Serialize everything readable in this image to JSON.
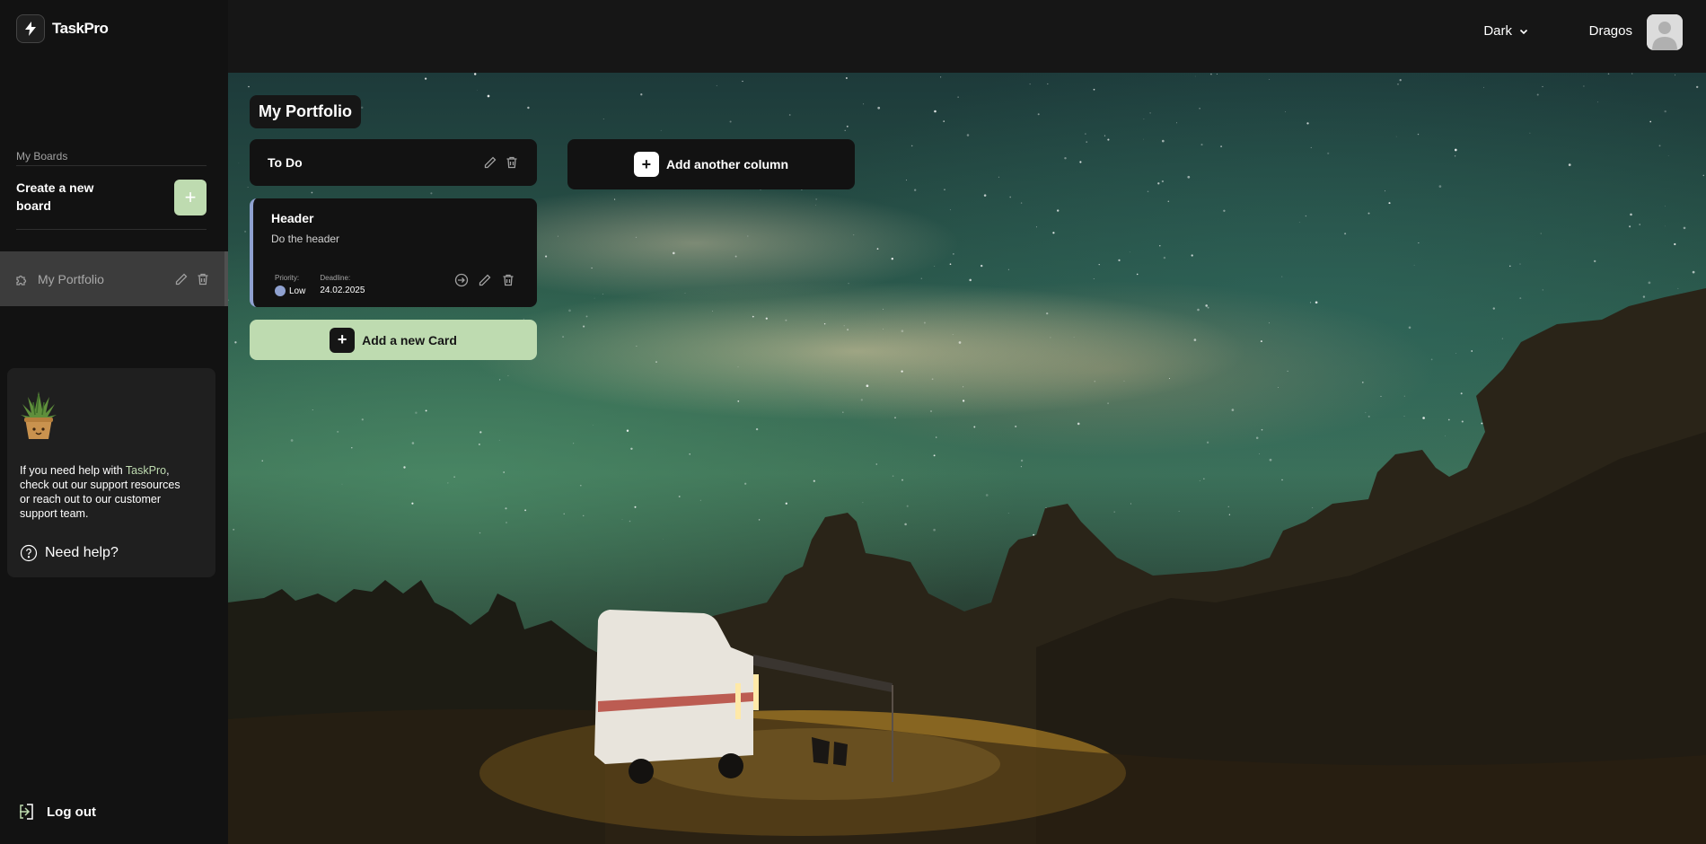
{
  "app": {
    "name": "TaskPro"
  },
  "sidebar": {
    "boards_label": "My Boards",
    "create_label": "Create a new board",
    "create_button": "+",
    "boards": [
      {
        "name": "My Portfolio",
        "icon": "puzzle-icon"
      }
    ],
    "help": {
      "text_before": "If you need help with ",
      "text_accent": "TaskPro",
      "text_after": ", check out our support resources or reach out to our customer support team.",
      "link": "Need help?"
    },
    "logout": "Log out"
  },
  "header": {
    "theme": "Dark",
    "user": "Dragos"
  },
  "board": {
    "title": "My Portfolio",
    "columns": [
      {
        "title": "To Do",
        "cards": [
          {
            "title": "Header",
            "description": "Do the header",
            "priority_label": "Priority:",
            "priority": "Low",
            "deadline_label": "Deadline:",
            "deadline": "24.02.2025"
          }
        ],
        "add_card": "Add a new Card"
      }
    ],
    "add_column": "Add another column"
  },
  "colors": {
    "accent": "#bedbb0",
    "priority_low": "#8fa1d0",
    "sidebar_bg": "#121212"
  }
}
